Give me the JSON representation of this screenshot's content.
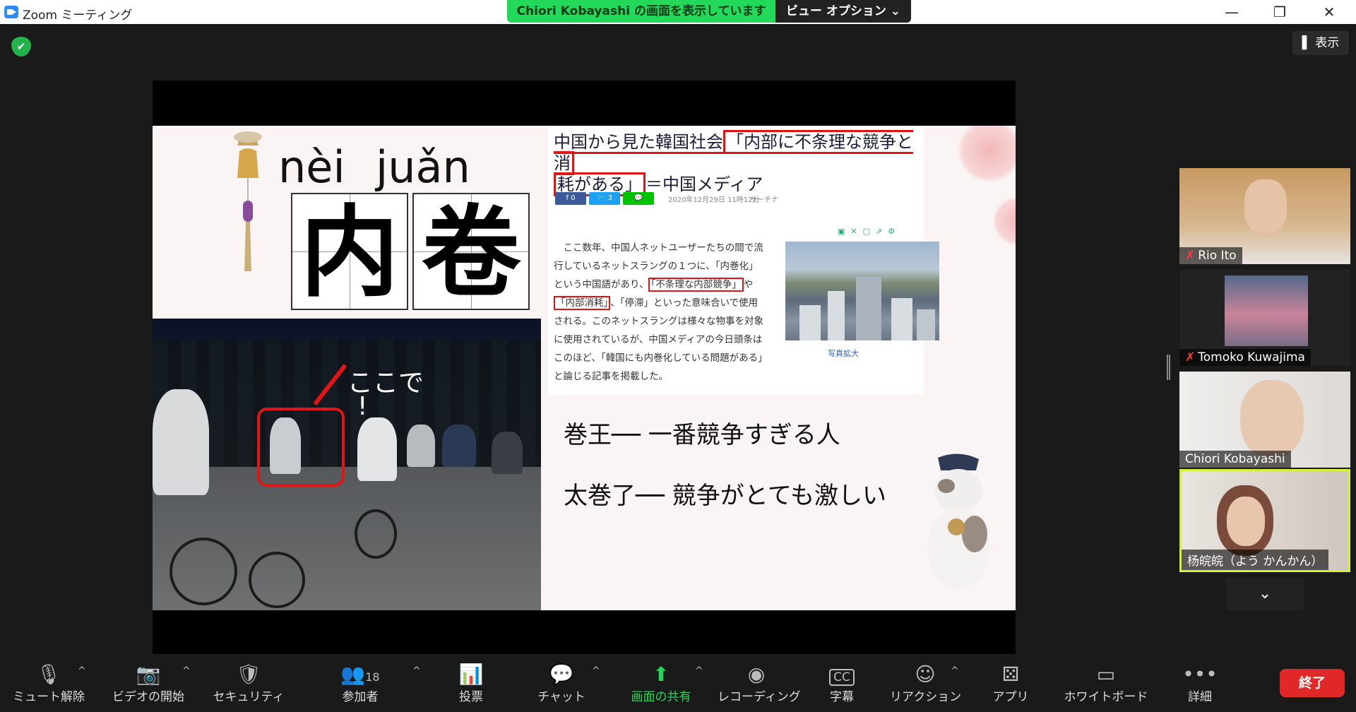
{
  "window": {
    "title": "Zoom ミーティング",
    "share_banner": "Chiori  Kobayashi の画面を表示しています",
    "view_options": "ビュー オプション ⌄",
    "minimize": "—",
    "restore": "❐",
    "close": "✕"
  },
  "top_right": {
    "show_button": "表示"
  },
  "slide": {
    "pinyin": [
      "nèi",
      "juǎn"
    ],
    "characters": [
      "内",
      "卷"
    ],
    "photo_callout": "ここで",
    "photo_callout_mark": "!",
    "article": {
      "headline_prefix": "中国から見た韓国社会",
      "headline_boxed_1": "「内部に不条理な競争と消",
      "headline_boxed_2": "耗がある」",
      "headline_suffix": "＝中国メディア",
      "fb_count": "0",
      "tw_count": "3",
      "date": "2020年12月29日 11時12分",
      "source": "サーチナ",
      "body_1": "ここ数年、中国人ネットユーザーたちの間で流行しているネットスラングの１つに、「内巻化」という中国語があり、",
      "body_boxed_1": "「不条理な内部競争」",
      "body_2": "や",
      "body_boxed_2": "「内部消耗」",
      "body_3": "、「停滞」といった意味合いで使用される。このネットスラングは様々な物事を対象に使用されているが、中国メディアの今日頭条はこのほど、「韓国にも内巻化している問題がある」と論じる記事を掲載した。",
      "image_caption": "写真拡大"
    },
    "term_1": "巻王── 一番競争すぎる人",
    "term_2": "太巻了── 競争がとても激しい"
  },
  "participants": [
    {
      "name": "Rio Ito",
      "muted": true
    },
    {
      "name": "Tomoko Kuwajima",
      "muted": true
    },
    {
      "name": "Chiori Kobayashi",
      "muted": false
    },
    {
      "name": "杨皖皖（よう かんかん）",
      "muted": false,
      "active": true
    }
  ],
  "participant_scroll": "⌄",
  "toolbar": {
    "unmute": "ミュート解除",
    "start_video": "ビデオの開始",
    "security": "セキュリティ",
    "participants": "参加者",
    "participants_count": "18",
    "polls": "投票",
    "chat": "チャット",
    "share_screen": "画面の共有",
    "recording": "レコーディング",
    "captions": "字幕",
    "captions_icon": "CC",
    "reactions": "リアクション",
    "apps": "アプリ",
    "whiteboard": "ホワイトボード",
    "more": "詳細",
    "end": "終了"
  },
  "colors": {
    "zoom_green": "#23d959",
    "end_red": "#e02828",
    "annotation_red": "#e01616",
    "active_speaker": "#d4ef3c"
  }
}
